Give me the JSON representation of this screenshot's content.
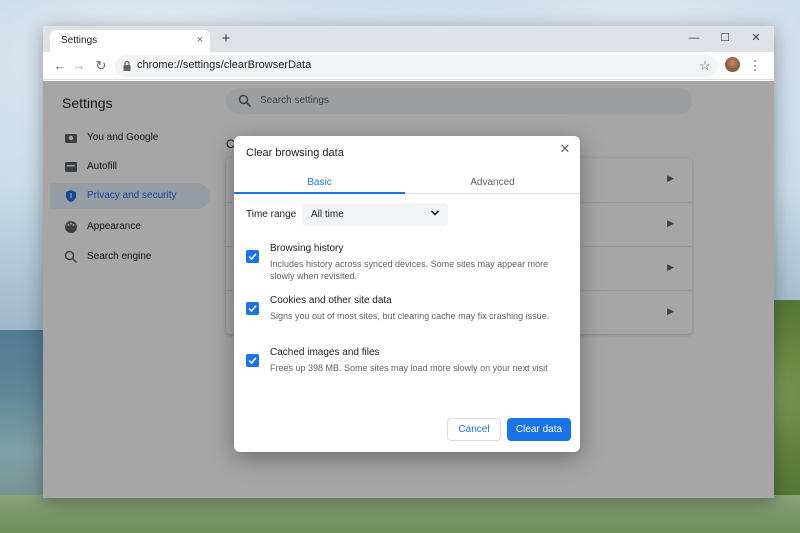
{
  "tab": {
    "title": "Settings",
    "close_glyph": "×"
  },
  "new_tab_glyph": "+",
  "window_controls": {
    "minimize": "—",
    "maximize": "☐",
    "close": "✕"
  },
  "toolbar": {
    "back": "←",
    "forward": "→",
    "reload": "↻",
    "url": "chrome://settings/clearBrowserData",
    "star": "☆",
    "menu": "⋮"
  },
  "settings": {
    "title": "Settings",
    "search_placeholder": "Search settings",
    "section_heading_initial": "C",
    "sidebar": [
      {
        "label": "You and Google",
        "icon": "person-icon"
      },
      {
        "label": "Autofill",
        "icon": "autofill-icon"
      },
      {
        "label": "Privacy and security",
        "icon": "shield-icon",
        "active": true
      },
      {
        "label": "Appearance",
        "icon": "palette-icon"
      },
      {
        "label": "Search engine",
        "icon": "search-icon"
      }
    ]
  },
  "dialog": {
    "title": "Clear browsing data",
    "close_glyph": "✕",
    "tabs": {
      "basic": "Basic",
      "advanced": "Advanced"
    },
    "time_range_label": "Time range",
    "time_range_value": "All time",
    "items": [
      {
        "title": "Browsing history",
        "description": "Includes history across synced devices. Some sites may appear more slowly when revisited.",
        "checked": true
      },
      {
        "title": "Cookies and other site data",
        "description": "Signs you out of most sites, but clearing cache may fix crashing issue.",
        "checked": true
      },
      {
        "title": "Cached images and files",
        "description": "Frees up 398 MB. Some sites may load more slowly on your next visit",
        "checked": true
      }
    ],
    "cancel_label": "Cancel",
    "clear_label": "Clear data"
  },
  "colors": {
    "accent": "#1a73e8",
    "overlay": "rgba(0,0,0,0.35)",
    "select_bg": "#f1f3f4"
  }
}
